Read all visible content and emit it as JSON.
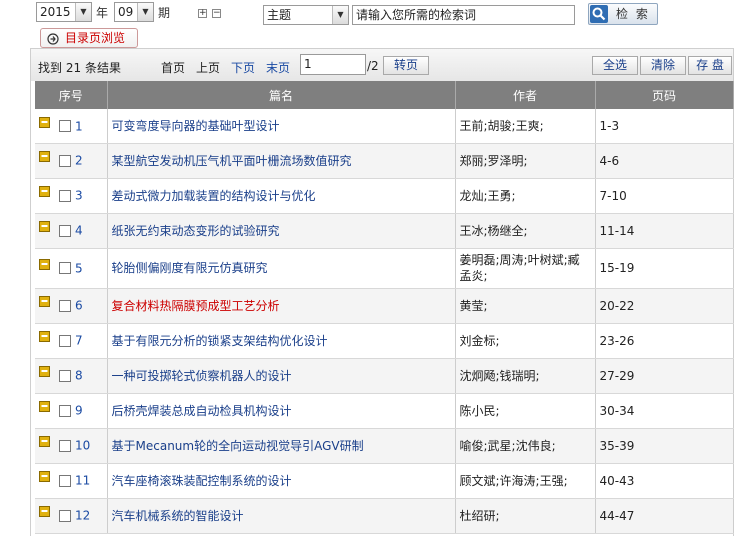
{
  "filters": {
    "year": "2015",
    "year_label": "年",
    "issue": "09",
    "issue_label": "期",
    "expand_icon": "plus-box-icon",
    "collapse_icon": "minus-box-icon",
    "field": "主题",
    "search_placeholder": "请输入您所需的检索词",
    "search_label": "检 索",
    "catalog_label": "目录页浏览"
  },
  "toolbar": {
    "found_prefix": "找到",
    "found_count": "21",
    "found_suffix": "条结果",
    "first": "首页",
    "prev": "上页",
    "next": "下页",
    "last": "末页",
    "page_value": "1",
    "page_total": "/2",
    "go_label": "转页",
    "select_all": "全选",
    "clear": "清除",
    "save": "存 盘"
  },
  "table": {
    "headers": [
      "序号",
      "篇名",
      "作者",
      "页码"
    ],
    "rows": [
      {
        "n": "1",
        "title": "可变弯度导向器的基础叶型设计",
        "author": "王前;胡骏;王爽;",
        "pages": "1-3"
      },
      {
        "n": "2",
        "title": "某型航空发动机压气机平面叶栅流场数值研究",
        "author": "郑丽;罗泽明;",
        "pages": "4-6"
      },
      {
        "n": "3",
        "title": "差动式微力加载装置的结构设计与优化",
        "author": "龙灿;王勇;",
        "pages": "7-10"
      },
      {
        "n": "4",
        "title": "纸张无约束动态变形的试验研究",
        "author": "王冰;杨继全;",
        "pages": "11-14"
      },
      {
        "n": "5",
        "title": "轮胎侧偏刚度有限元仿真研究",
        "author": "姜明磊;周涛;叶树斌;臧孟炎;",
        "pages": "15-19"
      },
      {
        "n": "6",
        "title": "复合材料热隔膜预成型工艺分析",
        "author": "黄莹;",
        "pages": "20-22"
      },
      {
        "n": "7",
        "title": "基于有限元分析的锁紧支架结构优化设计",
        "author": "刘金标;",
        "pages": "23-26"
      },
      {
        "n": "8",
        "title": "一种可投掷轮式侦察机器人的设计",
        "author": "沈炯飏;钱瑞明;",
        "pages": "27-29"
      },
      {
        "n": "9",
        "title": "后桥壳焊装总成自动检具机构设计",
        "author": "陈小民;",
        "pages": "30-34"
      },
      {
        "n": "10",
        "title": "基于Mecanum轮的全向运动视觉导引AGV研制",
        "author": "喻俊;武星;沈伟良;",
        "pages": "35-39"
      },
      {
        "n": "11",
        "title": "汽车座椅滚珠装配控制系统的设计",
        "author": "顾文斌;许海涛;王强;",
        "pages": "40-43"
      },
      {
        "n": "12",
        "title": "汽车机械系统的智能设计",
        "author": "杜绍研;",
        "pages": "44-47"
      }
    ]
  },
  "colors": {
    "header_bg": "#7f7f7f",
    "link": "#1a3f8a",
    "highlight": "#cc0000",
    "doc_icon": "#e0b10f"
  }
}
